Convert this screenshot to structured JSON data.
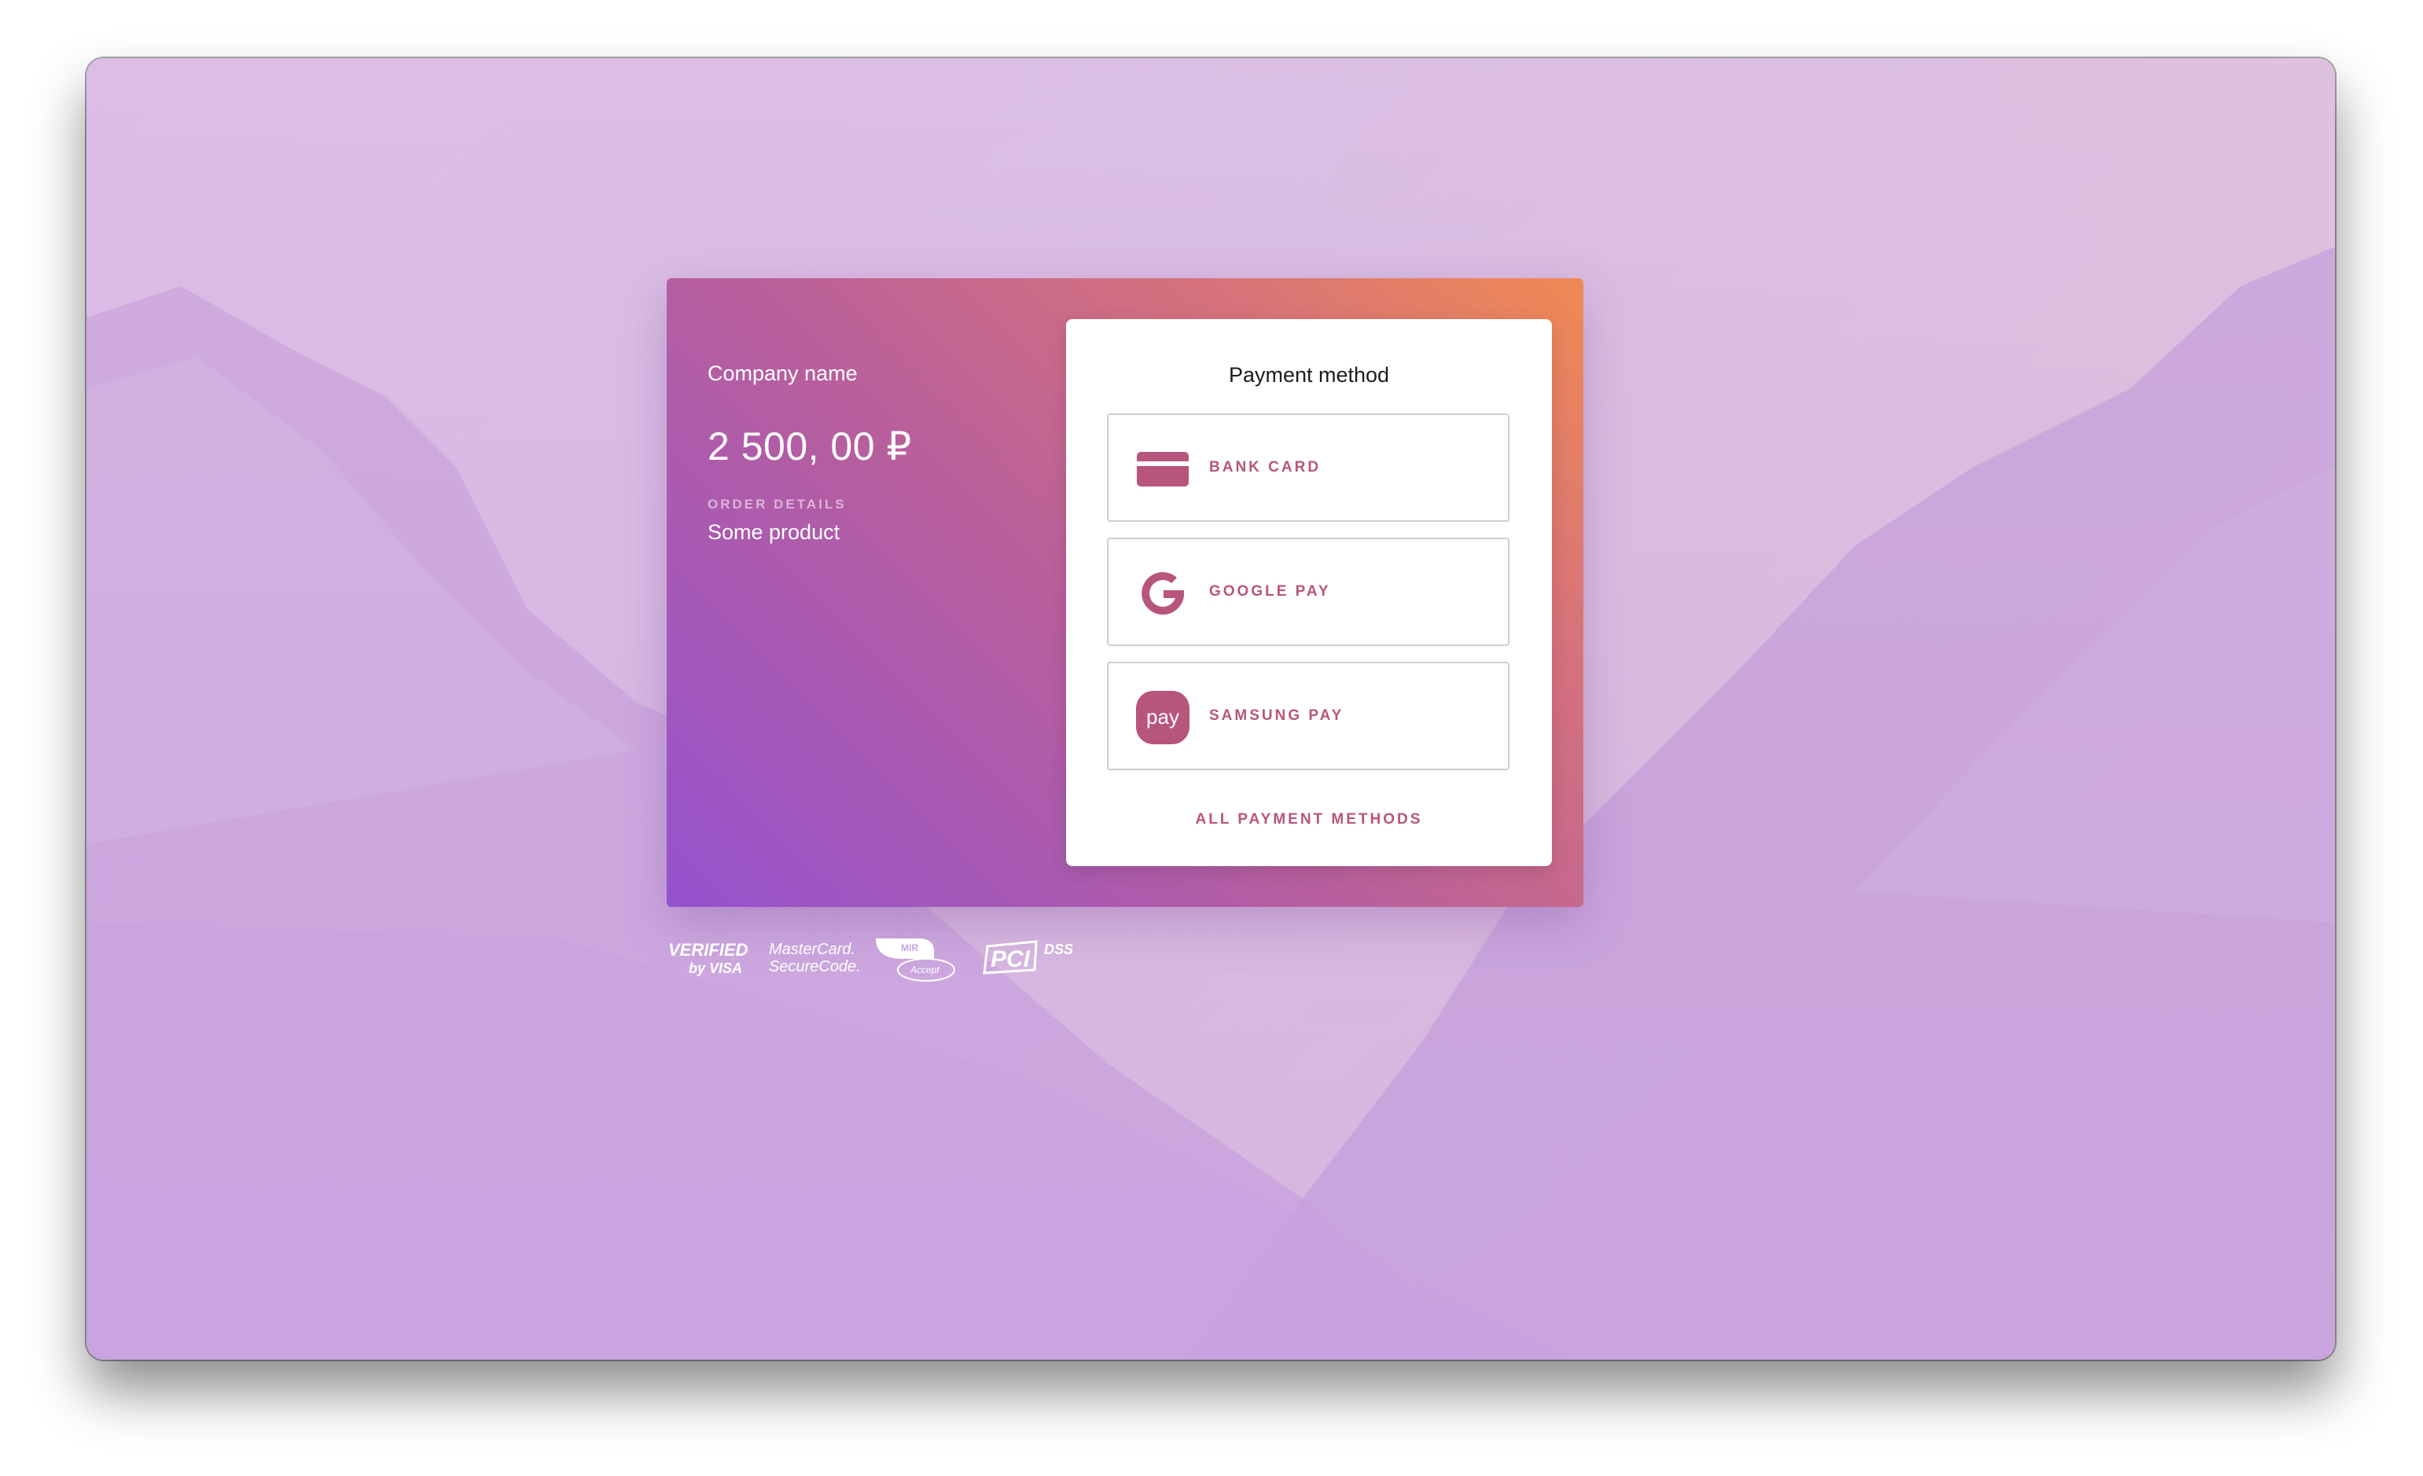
{
  "order": {
    "company_name": "Company name",
    "amount": "2 500, 00 ₽",
    "details_label": "ORDER DETAILS",
    "product": "Some product"
  },
  "payment": {
    "title": "Payment method",
    "methods": [
      {
        "label": "BANK CARD",
        "icon": "bank-card-icon"
      },
      {
        "label": "GOOGLE PAY",
        "icon": "google-icon"
      },
      {
        "label": "SAMSUNG PAY",
        "icon": "samsung-pay-icon"
      }
    ],
    "all_methods_label": "ALL PAYMENT METHODS"
  },
  "security_logos": {
    "verified_by_visa": [
      "VERIFIED",
      "by VISA"
    ],
    "mastercard_securecode": [
      "MasterCard.",
      "SecureCode."
    ],
    "mir_accept": [
      "MIR",
      "Accept"
    ],
    "pci_dss": [
      "PCI",
      "DSS"
    ]
  },
  "colors": {
    "accent": "#b8557c",
    "gradient_start": "#9552cf",
    "gradient_end": "#f08a53"
  }
}
